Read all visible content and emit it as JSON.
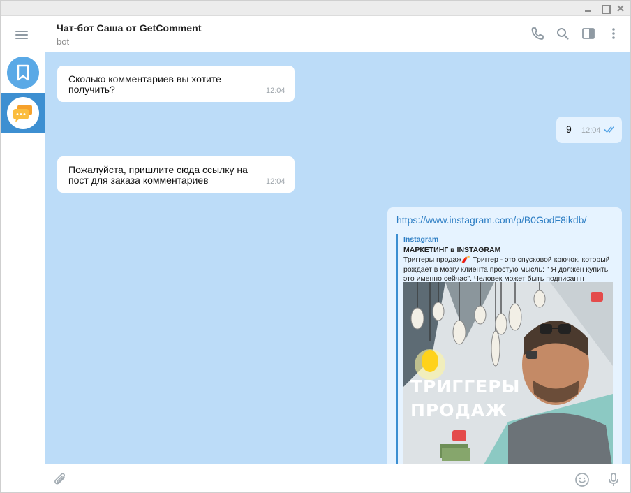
{
  "window": {
    "controls": [
      "minimize",
      "maximize",
      "close"
    ]
  },
  "chat": {
    "title": "Чат-бот Саша от GetComment",
    "subtitle": "bot"
  },
  "header_icons": [
    "phone-icon",
    "search-icon",
    "side-panel-icon",
    "more-vertical-icon"
  ],
  "messages": [
    {
      "direction": "incoming",
      "text": "Сколько комментариев вы хотите получить?",
      "time": "12:04"
    },
    {
      "direction": "outgoing",
      "text": "9",
      "time": "12:04",
      "status": "read"
    },
    {
      "direction": "incoming",
      "text": "Пожалуйста, пришлите сюда ссылку на пост для заказа комментариев",
      "time": "12:04"
    },
    {
      "direction": "outgoing",
      "link": "https://www.instagram.com/p/B0GodF8ikdb/",
      "preview": {
        "site": "Instagram",
        "title": "МАРКЕТИНГ в INSTAGRAM",
        "description": "Триггеры продаж🧨   Триггер - это спусковой крючок, который рождает в мозгу клиента простую мысль: \" Я должен купить это именно сейчас\". Человек может быть подписан н",
        "image_text_line1": "ТРИГГЕРЫ",
        "image_text_line2": "ПРОДАЖ"
      }
    }
  ],
  "composer": {
    "placeholder": ""
  },
  "colors": {
    "accent": "#3d8fd1",
    "chat_bg": "#bcdcf8",
    "link": "#2d7ec4",
    "outgoing_bubble": "#e6f3ff"
  }
}
